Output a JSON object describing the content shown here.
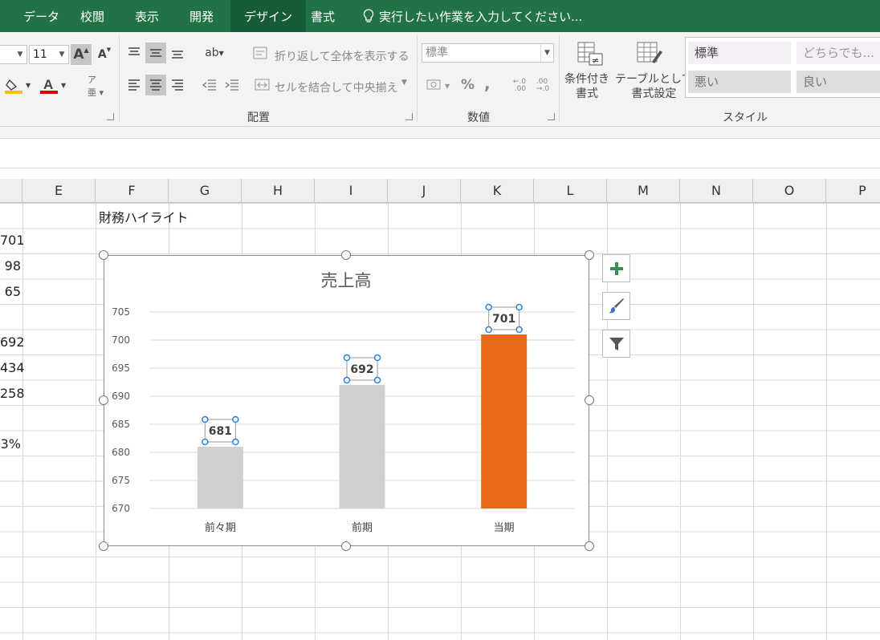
{
  "tabs": [
    {
      "label": "データ",
      "active": false
    },
    {
      "label": "校閲",
      "active": false
    },
    {
      "label": "表示",
      "active": false
    },
    {
      "label": "開発",
      "active": false
    },
    {
      "label": "デザイン",
      "active": true
    },
    {
      "label": "書式",
      "active": false
    }
  ],
  "tell_me": "実行したい作業を入力してください...",
  "font": {
    "size": "11"
  },
  "alignment": {
    "wrap_text": "折り返して全体を表示する",
    "merge_center": "セルを結合して中央揃え",
    "group_label": "配置"
  },
  "number": {
    "format": "標準",
    "percent": "%",
    "comma": ",",
    "inc_decimal": "←.0\n.00",
    "dec_decimal": ".00\n→.0",
    "group_label": "数値"
  },
  "styles": {
    "conditional_formatting": "条件付き\n書式",
    "format_as_table": "テーブルとして\n書式設定",
    "cells": [
      {
        "label": "標準"
      },
      {
        "label": "どちらでも..."
      },
      {
        "label": "悪い"
      },
      {
        "label": "良い"
      }
    ],
    "group_label": "スタイル"
  },
  "columns": [
    "E",
    "F",
    "G",
    "H",
    "I",
    "J",
    "K",
    "L",
    "M",
    "N",
    "O",
    "P"
  ],
  "cells": {
    "title": "財務ハイライト",
    "d_values": [
      "701",
      "98",
      "65",
      "",
      "692",
      "434",
      "258",
      "",
      "3%"
    ]
  },
  "colors": {
    "excel_green": "#217346",
    "bar_gray": "#d0d0d0",
    "bar_highlight": "#e8681a",
    "label_selection": "#2f7fd8"
  },
  "chart_data": {
    "type": "bar",
    "title": "売上高",
    "categories": [
      "前々期",
      "前期",
      "当期"
    ],
    "values": [
      681,
      692,
      701
    ],
    "highlight_index": 2,
    "ylim": [
      670,
      705
    ],
    "yticks": [
      670,
      675,
      680,
      685,
      690,
      695,
      700,
      705
    ],
    "grid": true,
    "legend": "none",
    "data_labels": [
      "681",
      "692",
      "701"
    ],
    "selected": true
  }
}
